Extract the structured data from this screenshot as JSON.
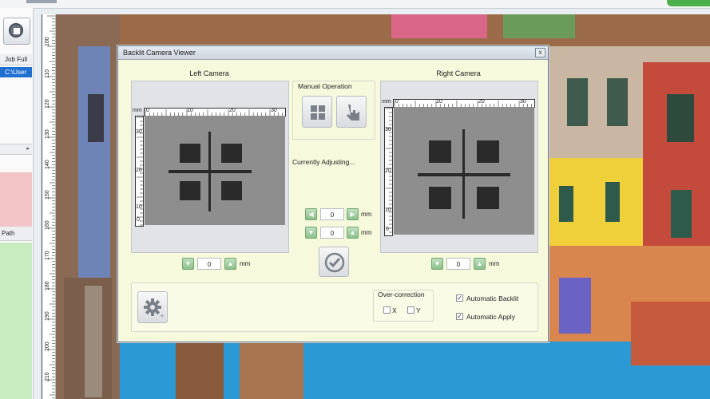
{
  "left_panel": {
    "job_header": "Job Full",
    "job_row": "C:\\User",
    "path_header": "Path"
  },
  "ruler": {
    "labels": [
      "100",
      "110",
      "120",
      "130",
      "140",
      "150",
      "160",
      "170",
      "180",
      "190",
      "200",
      "210"
    ]
  },
  "dialog": {
    "title": "Backlit Camera Viewer",
    "close_glyph": "x",
    "left_camera": {
      "label": "Left Camera",
      "unit_corner": "mm",
      "h_ticks": [
        "0",
        "10",
        "20",
        "30"
      ],
      "v_ticks": [
        "30",
        "20",
        "10",
        "0"
      ],
      "value": "0",
      "unit": "mm"
    },
    "right_camera": {
      "label": "Right Camera",
      "unit_corner": "mm",
      "h_ticks": [
        "0",
        "10",
        "20",
        "30"
      ],
      "v_ticks": [
        "30",
        "20",
        "10",
        "0"
      ],
      "value": "0",
      "unit": "mm"
    },
    "manual_operation": {
      "label": "Manual Operation"
    },
    "status": "Currently Adjusting...",
    "x_adjust": {
      "value": "0",
      "unit": "mm"
    },
    "y_adjust": {
      "value": "0",
      "unit": "mm"
    },
    "over_correction": {
      "label": "Over-correction",
      "x_label": "X",
      "y_label": "Y",
      "x_checked": false,
      "y_checked": false
    },
    "automatic_backlit": {
      "label": "Automatic Backlit",
      "checked": true
    },
    "automatic_apply": {
      "label": "Automatic Apply",
      "checked": true
    }
  },
  "icons": {
    "stop": "stop-icon",
    "grid": "grid-icon",
    "hand": "hand-icon",
    "check": "check-icon",
    "settings": "gear-icon",
    "up": "chevron-up-icon",
    "down": "chevron-down-icon",
    "left": "chevron-left-icon",
    "right": "chevron-right-icon"
  },
  "colors": {
    "dialog_bg": "#f6f9dc",
    "spin_green": "#8cc08c",
    "selection_blue": "#1f6fd1"
  }
}
